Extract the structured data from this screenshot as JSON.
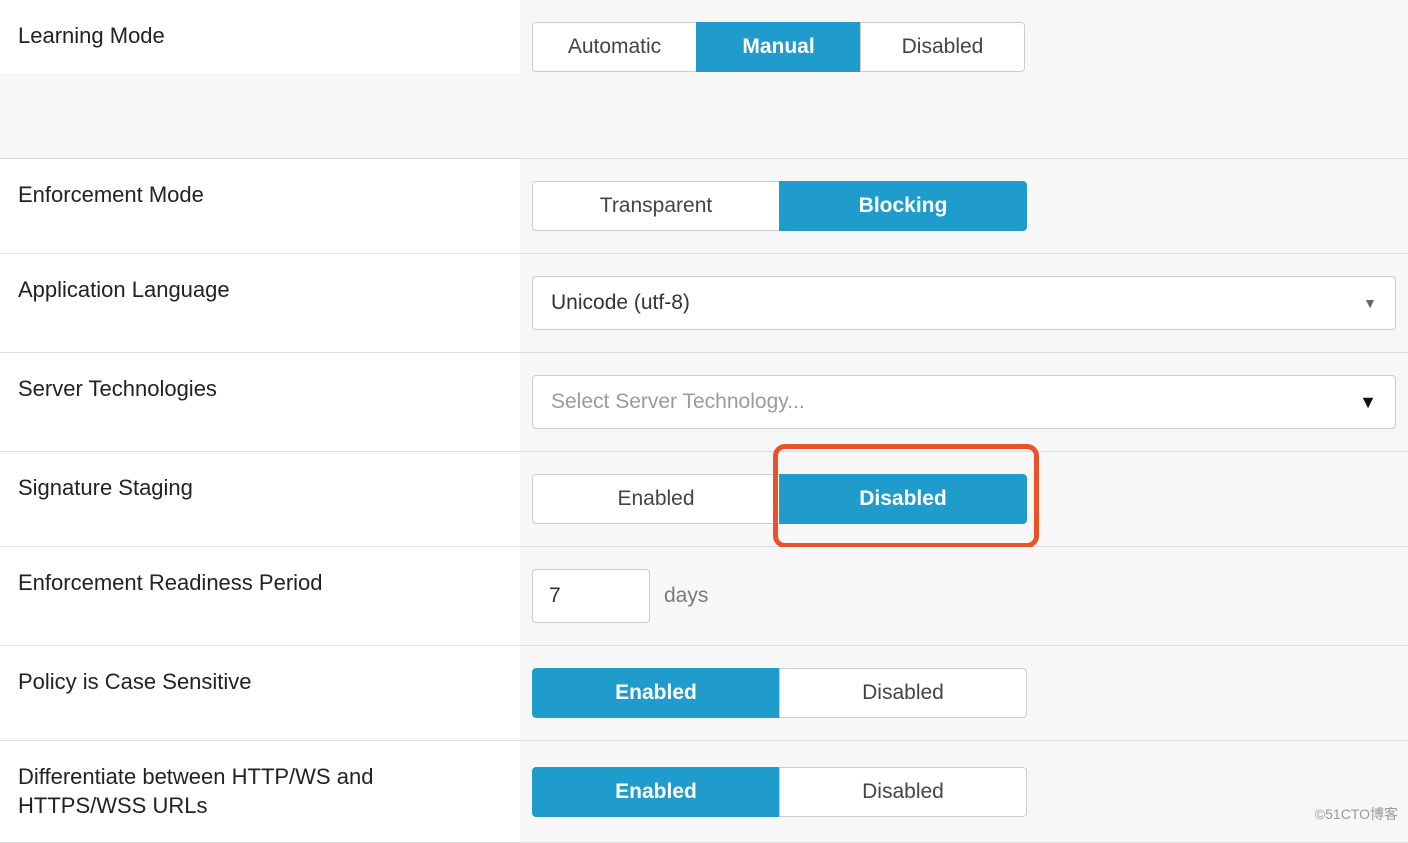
{
  "learning_mode": {
    "label": "Learning Mode",
    "options": {
      "automatic": "Automatic",
      "manual": "Manual",
      "disabled": "Disabled"
    },
    "selected": "manual"
  },
  "enforcement_mode": {
    "label": "Enforcement Mode",
    "options": {
      "transparent": "Transparent",
      "blocking": "Blocking"
    },
    "selected": "blocking"
  },
  "application_language": {
    "label": "Application Language",
    "value": "Unicode (utf-8)"
  },
  "server_technologies": {
    "label": "Server Technologies",
    "placeholder": "Select Server Technology..."
  },
  "signature_staging": {
    "label": "Signature Staging",
    "options": {
      "enabled": "Enabled",
      "disabled": "Disabled"
    },
    "selected": "disabled"
  },
  "enforcement_readiness_period": {
    "label": "Enforcement Readiness Period",
    "value": "7",
    "unit": "days"
  },
  "policy_case_sensitive": {
    "label": "Policy is Case Sensitive",
    "options": {
      "enabled": "Enabled",
      "disabled": "Disabled"
    },
    "selected": "enabled"
  },
  "differentiate_http": {
    "label": "Differentiate between HTTP/WS and HTTPS/WSS URLs",
    "options": {
      "enabled": "Enabled",
      "disabled": "Disabled"
    },
    "selected": "enabled"
  },
  "watermark": "©51CTO博客"
}
